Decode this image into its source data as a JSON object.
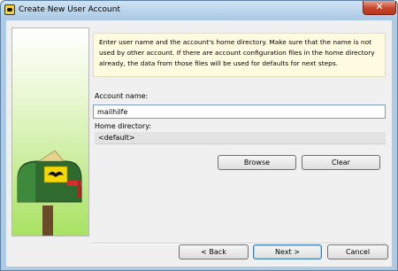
{
  "window": {
    "title": "Create New User Account",
    "close_glyph": "✕"
  },
  "info": {
    "text": "Enter user name and the account's home directory. Make sure that the name is not used by other account. If there are account configuration files in the home directory already, the data from those files will be used for defaults for next steps."
  },
  "account": {
    "label": "Account name:",
    "value": "mailhilfe"
  },
  "home": {
    "label": "Home directory:",
    "value": "<default>"
  },
  "buttons": {
    "browse": "Browse",
    "clear": "Clear",
    "back": "< Back",
    "next": "Next >",
    "cancel": "Cancel"
  },
  "colors": {
    "sidebar_green": "#a8e262",
    "info_bg": "#fffbe1",
    "close_red": "#c7462b",
    "mailbox_green": "#2f6b2f",
    "flag_red": "#d22e2e",
    "logo_yellow": "#f5d800"
  },
  "icons": {
    "app": "bat-logo-icon",
    "sidebar": "mailbox-illustration"
  }
}
